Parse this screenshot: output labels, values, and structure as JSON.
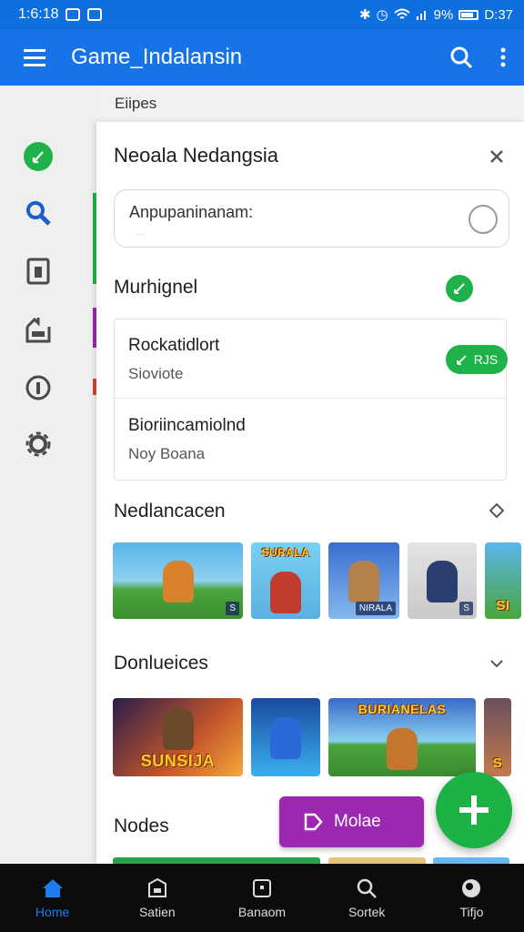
{
  "status_bar": {
    "time": "1:6:18",
    "battery": "9%",
    "clock_right": "D:37"
  },
  "app_bar": {
    "title": "Game_Indalansin",
    "menu_icon": "menu-icon",
    "search_icon": "search-icon",
    "more_icon": "more-vert-icon"
  },
  "rail": {
    "items": [
      "edit-check-icon",
      "search-icon",
      "document-icon",
      "home-box-icon",
      "info-icon",
      "settings-icon"
    ]
  },
  "background_label": "Eiipes",
  "sheet": {
    "title": "Neoala Nedangsia",
    "input": {
      "label": "Anpupaninanam:",
      "placeholder": "..."
    },
    "toggle_label": "Murhignel",
    "card": {
      "row1": {
        "title": "Rockatidlort",
        "subtitle": "Sioviote",
        "pill": "RJS"
      },
      "row2": {
        "title": "Bioriincamiolnd",
        "subtitle": "Noy Boana"
      }
    },
    "sections": [
      {
        "title": "Nedlancacen"
      },
      {
        "title": "Donlueices"
      },
      {
        "title": "Nodes"
      }
    ],
    "row1_thumbs": [
      {
        "badge": "S"
      },
      {
        "banner": "SURALA"
      },
      {
        "badge": "NIRALA"
      },
      {
        "badge": "S"
      },
      {
        "banner": "SI"
      }
    ],
    "row2_thumbs": [
      {
        "banner": "SUNSIJA"
      },
      {
        "banner": ""
      },
      {
        "banner": "BURIANELAS"
      },
      {
        "banner": "S"
      }
    ]
  },
  "fab_extended": {
    "label": "Molae"
  },
  "bottom_nav": [
    {
      "label": "Home",
      "icon": "home-icon",
      "active": true
    },
    {
      "label": "Satien",
      "icon": "store-icon",
      "active": false
    },
    {
      "label": "Banaom",
      "icon": "library-icon",
      "active": false
    },
    {
      "label": "Sortek",
      "icon": "search-icon",
      "active": false
    },
    {
      "label": "Tifjo",
      "icon": "profile-icon",
      "active": false
    }
  ],
  "colors": {
    "primary": "#1774e8",
    "green": "#1fb24a",
    "purple": "#9c27b0",
    "nav_bg": "#0c0c0c"
  }
}
